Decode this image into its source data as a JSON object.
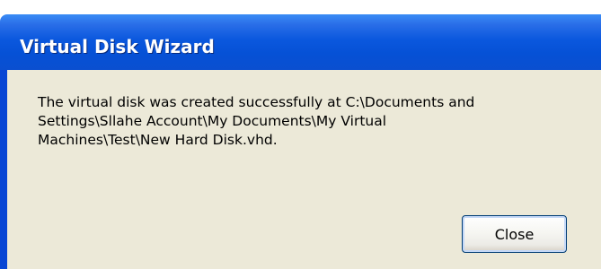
{
  "dialog": {
    "title": "Virtual Disk Wizard",
    "message": "The virtual disk was created successfully at C:\\Documents and\nSettings\\Sllahe Account\\My Documents\\My Virtual\nMachines\\Test\\New Hard Disk.vhd.",
    "close_label": "Close"
  },
  "colors": {
    "titlebar": "#0651d6",
    "client_background": "#ece9d8",
    "button_border": "#003c74"
  }
}
